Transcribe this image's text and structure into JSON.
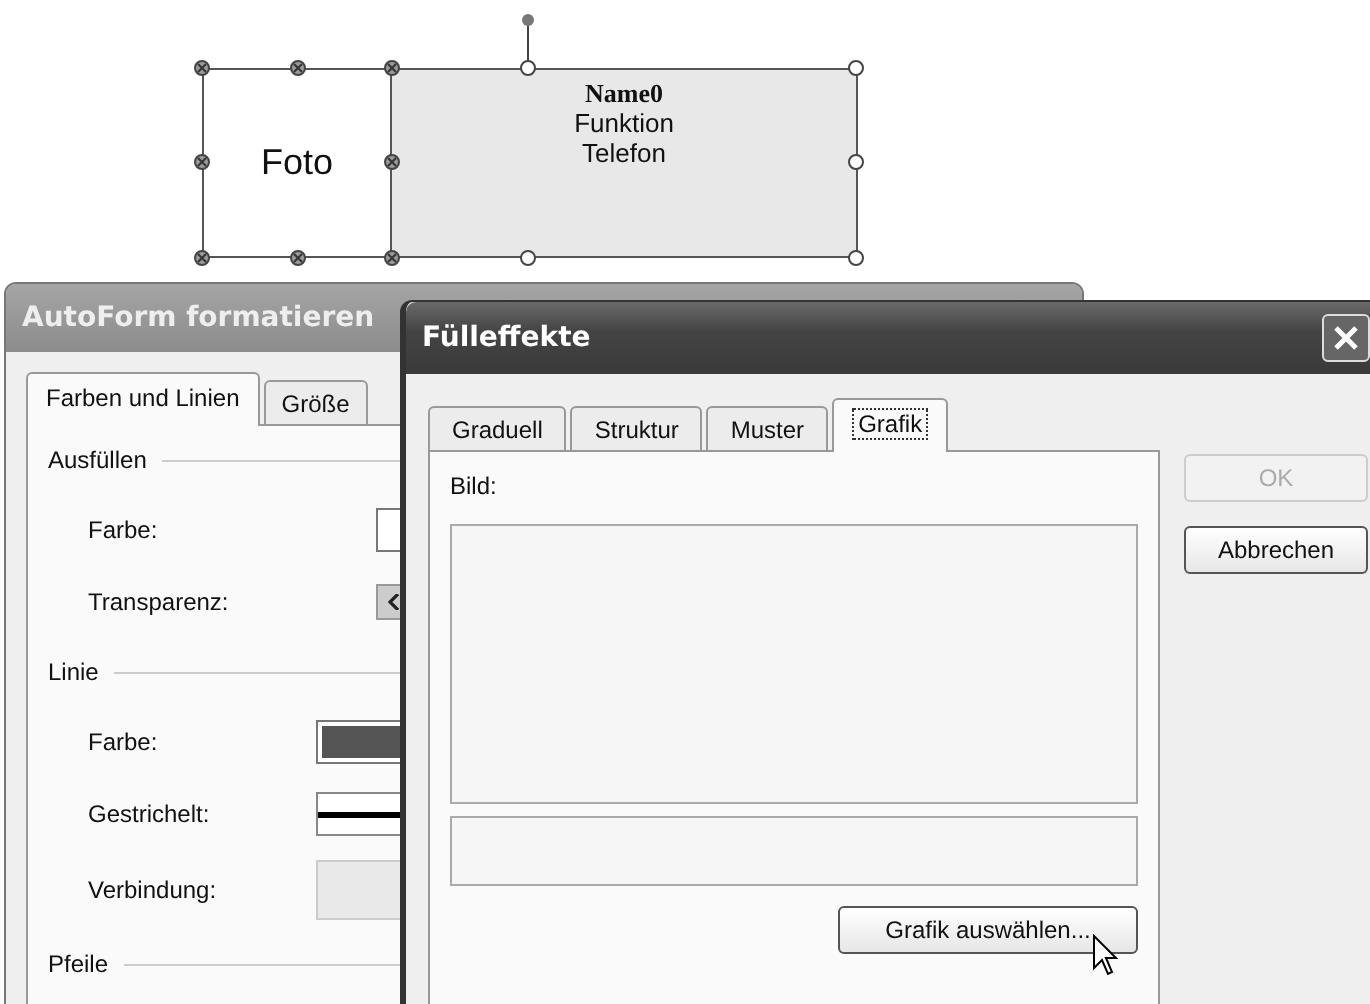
{
  "diagram": {
    "shapes": [
      {
        "kind": "photo",
        "lines": [
          {
            "text": "Foto",
            "bold": false
          }
        ]
      },
      {
        "kind": "card",
        "lines": [
          {
            "text": "Name0",
            "bold": true
          },
          {
            "text": "Funktion",
            "bold": false
          },
          {
            "text": "Telefon",
            "bold": false
          }
        ]
      }
    ]
  },
  "back_dialog": {
    "title": "AutoForm formatieren",
    "tabs": [
      {
        "label": "Farben und Linien",
        "selected": true
      },
      {
        "label": "Größe",
        "selected": false
      }
    ],
    "sections": [
      {
        "heading": "Ausfüllen",
        "rows": [
          {
            "label": "Farbe:",
            "kind": "color",
            "color": "#ffffff"
          },
          {
            "label": "Transparenz:",
            "kind": "slider"
          }
        ]
      },
      {
        "heading": "Linie",
        "rows": [
          {
            "label": "Farbe:",
            "kind": "color",
            "color": "#555555"
          },
          {
            "label": "Gestrichelt:",
            "kind": "line"
          },
          {
            "label": "Verbindung:",
            "kind": "disabled"
          }
        ]
      },
      {
        "heading": "Pfeile"
      }
    ]
  },
  "front_dialog": {
    "title": "Fülleffekte",
    "tabs": [
      {
        "label": "Graduell",
        "selected": false
      },
      {
        "label": "Struktur",
        "selected": false
      },
      {
        "label": "Muster",
        "selected": false
      },
      {
        "label": "Grafik",
        "selected": true
      }
    ],
    "picture_label": "Bild:",
    "select_button": "Grafik auswählen...",
    "buttons": [
      {
        "label": "OK",
        "disabled": true
      },
      {
        "label": "Abbrechen",
        "disabled": false
      }
    ]
  }
}
